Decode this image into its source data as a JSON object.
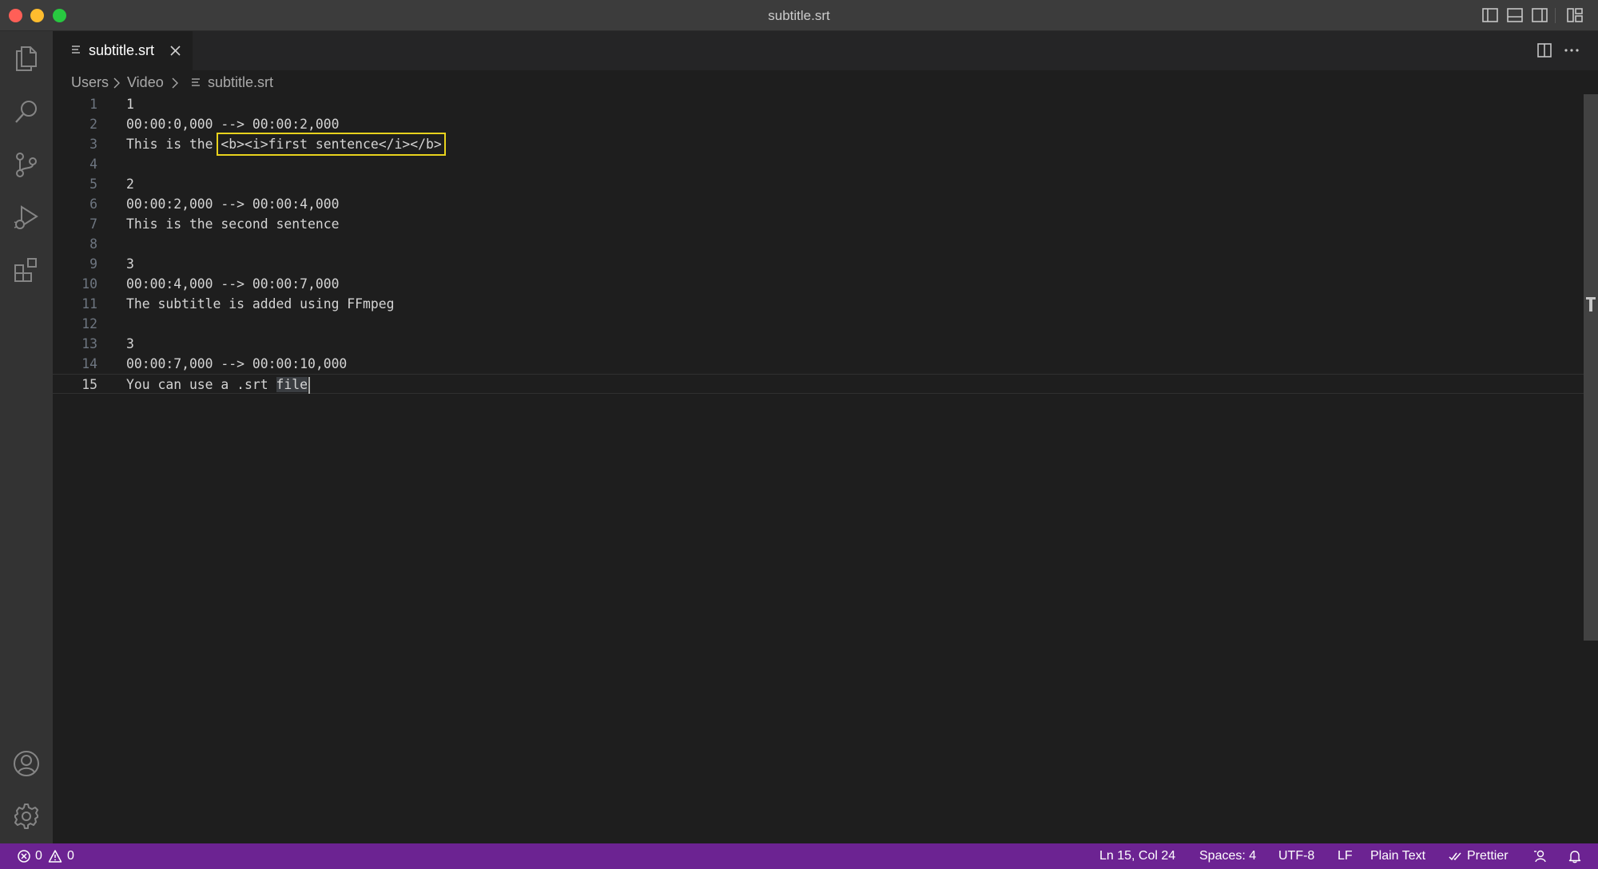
{
  "window": {
    "title": "subtitle.srt"
  },
  "tab": {
    "label": "subtitle.srt"
  },
  "breadcrumb": {
    "items": [
      "Users",
      "Video",
      "subtitle.srt"
    ]
  },
  "editor": {
    "lines": [
      {
        "num": "1",
        "text": "1"
      },
      {
        "num": "2",
        "text": "00:00:0,000 --> 00:00:2,000"
      },
      {
        "num": "3",
        "before": "This is the ",
        "highlight": "<b><i>first sentence</i></b>"
      },
      {
        "num": "4",
        "text": ""
      },
      {
        "num": "5",
        "text": "2"
      },
      {
        "num": "6",
        "text": "00:00:2,000 --> 00:00:4,000"
      },
      {
        "num": "7",
        "text": "This is the second sentence"
      },
      {
        "num": "8",
        "text": ""
      },
      {
        "num": "9",
        "text": "3"
      },
      {
        "num": "10",
        "text": "00:00:4,000 --> 00:00:7,000"
      },
      {
        "num": "11",
        "text": "The subtitle is added using FFmpeg"
      },
      {
        "num": "12",
        "text": ""
      },
      {
        "num": "13",
        "text": "3"
      },
      {
        "num": "14",
        "text": "00:00:7,000 --> 00:00:10,000"
      },
      {
        "num": "15",
        "before": "You can use a .srt ",
        "highlight": "file"
      }
    ],
    "current_line": 15
  },
  "statusbar": {
    "errors": "0",
    "warnings": "0",
    "position": "Ln 15, Col 24",
    "spaces": "Spaces: 4",
    "encoding": "UTF-8",
    "eol": "LF",
    "language": "Plain Text",
    "formatter": "Prettier"
  },
  "colors": {
    "statusbar_bg": "#6c2392",
    "highlight_box": "#e8d21d",
    "editor_bg": "#1e1e1e"
  },
  "icons": {
    "activity": [
      "explorer-icon",
      "search-icon",
      "source-control-icon",
      "run-debug-icon",
      "extensions-icon",
      "account-icon",
      "gear-icon"
    ]
  }
}
